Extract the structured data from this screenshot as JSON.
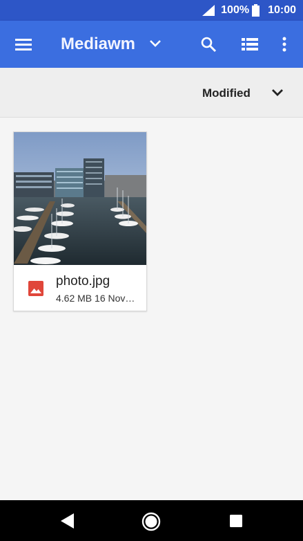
{
  "status_bar": {
    "battery_text": "100%",
    "clock": "10:00",
    "icons": [
      "signal-icon",
      "battery-icon"
    ]
  },
  "app_bar": {
    "title": "Mediawm",
    "icons": [
      "menu-icon",
      "chevron-down-icon",
      "search-icon",
      "list-view-icon",
      "more-vert-icon"
    ]
  },
  "sort_bar": {
    "label": "Modified",
    "icon": "chevron-down-icon"
  },
  "files": [
    {
      "name": "photo.jpg",
      "meta": "4.62 MB 16 Nov…",
      "icon": "image-file-icon",
      "icon_color": "#e0463a"
    }
  ],
  "nav_bar": {
    "icons": [
      "back-icon",
      "home-icon",
      "recents-icon"
    ]
  },
  "colors": {
    "status_bar": "#2d56c7",
    "app_bar": "#3b6ee0",
    "background": "#f5f5f5"
  }
}
